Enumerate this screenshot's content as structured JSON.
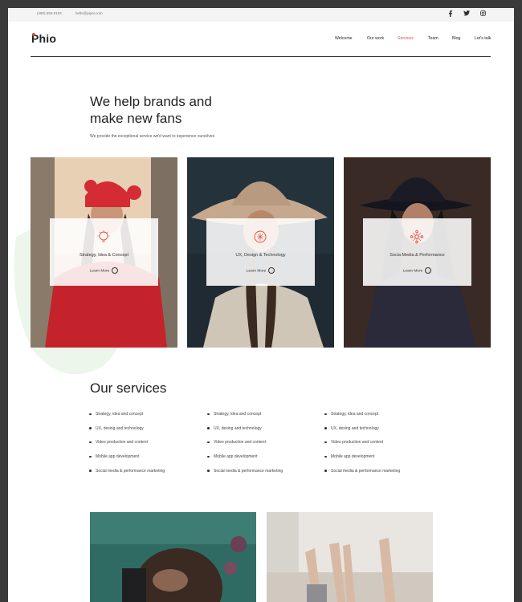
{
  "topbar": {
    "phone": "(480) 555-0103",
    "email": "hello@pipar.com",
    "social": [
      "facebook-icon",
      "twitter-icon",
      "instagram-icon"
    ]
  },
  "logo": {
    "text": "Phio"
  },
  "nav": {
    "items": [
      "Welcome",
      "Our work",
      "Services",
      "Team",
      "Blog",
      "Let's talk"
    ],
    "active_index": 2,
    "active_color": "#d9534f"
  },
  "hero": {
    "title_line1": "We help brands and",
    "title_line2": "make new fans",
    "subtitle": "We provide the exceptional service we'd want to experience ourselves"
  },
  "cards": [
    {
      "title": "Strategy, Idea & Concept",
      "link": "Learn More",
      "icon": "lightbulb-icon"
    },
    {
      "title": "UX, Design & Technology",
      "link": "Learn More",
      "icon": "design-icon"
    },
    {
      "title": "Socia Media & Performance",
      "link": "Learn More",
      "icon": "network-icon"
    }
  ],
  "services": {
    "title": "Our services",
    "columns": [
      [
        "Strategy, idea and concept",
        "UX, desing and technology",
        "Video production and content",
        "Mobile app development",
        "Social media & performance marketing"
      ],
      [
        "Strategy, idea and concept",
        "UX, desing and technology",
        "Video production and content",
        "Mobile app development",
        "Social media & performance marketing"
      ],
      [
        "Strategy, idea and concept",
        "UX, desing and technology",
        "Video production and content",
        "Mobile app development",
        "Social media & performance marketing"
      ]
    ]
  },
  "colors": {
    "accent": "#e2473a",
    "text": "#222222"
  }
}
